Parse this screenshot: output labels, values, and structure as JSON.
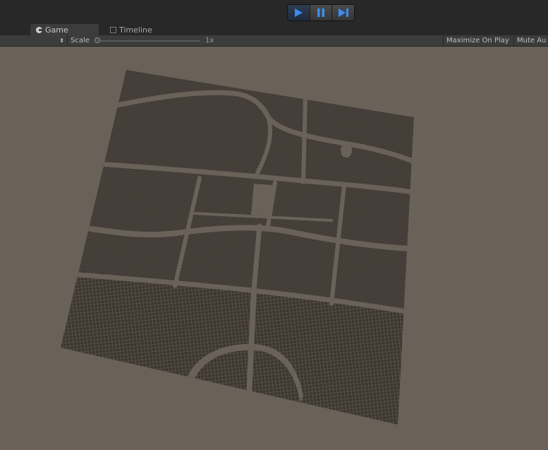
{
  "toolbar_top": {
    "controls": [
      {
        "name": "play-button",
        "icon": "play-icon",
        "active": true
      },
      {
        "name": "pause-button",
        "icon": "pause-icon",
        "active": false
      },
      {
        "name": "step-button",
        "icon": "step-icon",
        "active": false
      }
    ]
  },
  "tabs": [
    {
      "label": "Game",
      "icon": "game-icon"
    },
    {
      "label": "Timeline",
      "icon": "timeline-icon"
    }
  ],
  "game_toolbar": {
    "scale_label": "Scale",
    "scale_value": "1x",
    "maximize_label": "Maximize On Play",
    "mute_label": "Mute Au"
  },
  "colors": {
    "background": "#6a6159",
    "accent_blue": "#3d8cf5",
    "mesh": "#332f2b"
  }
}
